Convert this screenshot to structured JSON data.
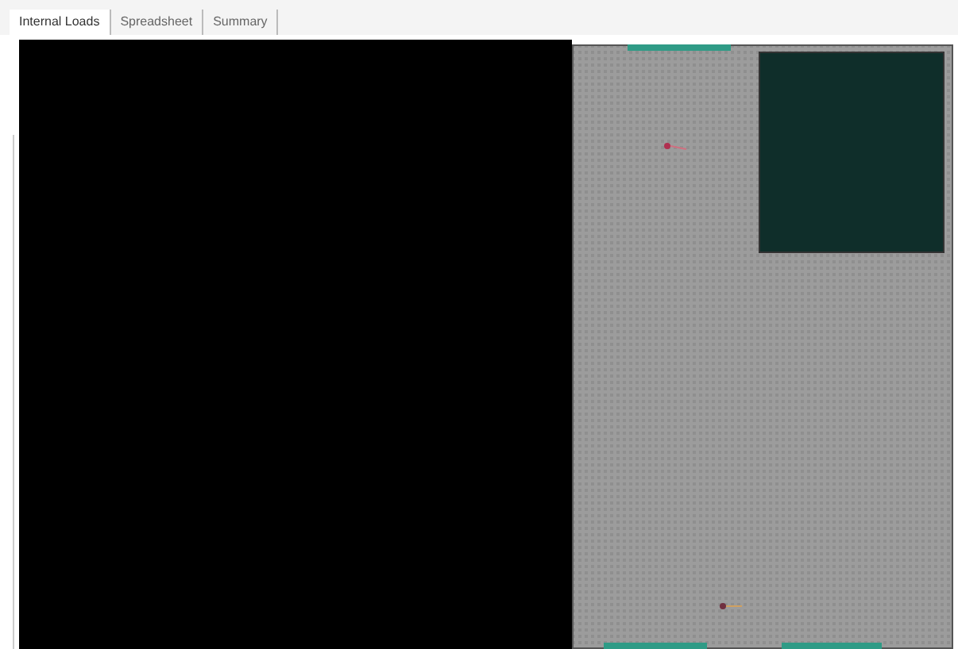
{
  "tabs": [
    {
      "label": "Internal Loads",
      "selected": true
    },
    {
      "label": "Spreadsheet",
      "selected": false
    },
    {
      "label": "Summary",
      "selected": false
    }
  ]
}
